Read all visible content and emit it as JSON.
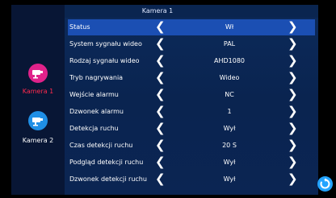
{
  "window": {
    "title": "Kamera 1"
  },
  "cameras": [
    {
      "label": "Kamera 1",
      "active": true,
      "color": "#e0228a"
    },
    {
      "label": "Kamera 2",
      "active": false,
      "color": "#1f8fe6"
    }
  ],
  "settings": [
    {
      "label": "Status",
      "value": "Wł"
    },
    {
      "label": "System sygnału wideo",
      "value": "PAL"
    },
    {
      "label": "Rodzaj sygnału wideo",
      "value": "AHD1080"
    },
    {
      "label": "Tryb nagrywania",
      "value": "Wideo"
    },
    {
      "label": "Wejście alarmu",
      "value": "NC"
    },
    {
      "label": "Dzwonek alarmu",
      "value": "1"
    },
    {
      "label": "Detekcja ruchu",
      "value": "Wył"
    },
    {
      "label": "Czas detekcji ruchu",
      "value": "20 S"
    },
    {
      "label": "Podgląd detekcji ruchu",
      "value": "Wył"
    },
    {
      "label": "Dzwonek detekcji ruchu",
      "value": "Wył"
    }
  ],
  "arrows": {
    "left": "❮",
    "right": "❯"
  },
  "colors": {
    "selected_row": "#1b4fb3",
    "active_camera_label": "#ff2a4d",
    "back_button": "#23a4ff"
  },
  "icons": {
    "back": "back-icon",
    "camera": "camera-icon"
  }
}
